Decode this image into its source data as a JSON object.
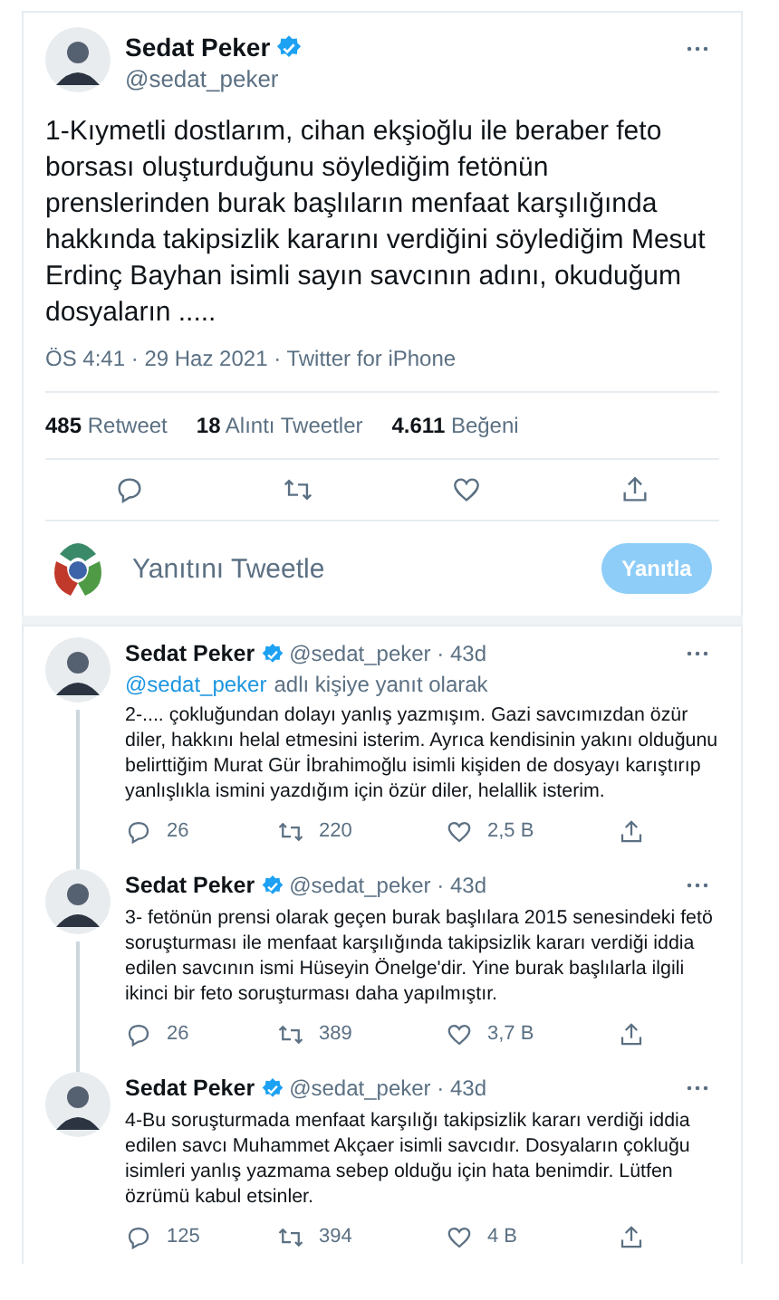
{
  "main_tweet": {
    "author": {
      "name": "Sedat Peker",
      "handle": "@sedat_peker",
      "verified": true
    },
    "text": "1-Kıymetli dostlarım, cihan ekşioğlu ile beraber feto borsası oluşturduğunu söylediğim fetönün prenslerinden burak başlıların menfaat karşılığında hakkında takipsizlik kararını verdiğini söylediğim Mesut Erdinç Bayhan isimli sayın savcının adını, okuduğum dosyaların .....",
    "meta": "ÖS 4:41 · 29 Haz 2021 · Twitter for iPhone",
    "stats": [
      {
        "count": "485",
        "label": "Retweet"
      },
      {
        "count": "18",
        "label": "Alıntı Tweetler"
      },
      {
        "count": "4.611",
        "label": "Beğeni"
      }
    ]
  },
  "reply_box": {
    "placeholder": "Yanıtını Tweetle",
    "button": {
      "label": "Yanıtla",
      "disabled": true
    }
  },
  "replies": [
    {
      "name": "Sedat Peker",
      "verified": true,
      "byline": "@sedat_peker · 43d",
      "replying_to": {
        "handle": "@sedat_peker",
        "text": "adlı kişiye yanıt olarak"
      },
      "text": "2-.... çokluğundan dolayı yanlış yazmışım. Gazi savcımızdan özür diler, hakkını helal etmesini isterim. Ayrıca kendisinin yakını olduğunu belirttiğim Murat Gür İbrahimoğlu isimli kişiden de dosyayı karıştırıp yanlışlıkla ismini yazdığım için özür diler, helallik isterim.",
      "replies": "26",
      "retweets": "220",
      "likes": "2,5 B"
    },
    {
      "name": "Sedat Peker",
      "verified": true,
      "byline": "@sedat_peker · 43d",
      "text": "3- fetönün prensi olarak geçen burak başlılara 2015 senesindeki fetö soruşturması ile menfaat karşılığında takipsizlik kararı verdiği iddia edilen savcının ismi Hüseyin Önelge'dir. Yine burak başlılarla ilgili ikinci bir feto soruşturması daha yapılmıştır.",
      "replies": "26",
      "retweets": "389",
      "likes": "3,7 B"
    },
    {
      "name": "Sedat Peker",
      "verified": true,
      "byline": "@sedat_peker · 43d",
      "text": "4-Bu soruşturmada menfaat karşılığı takipsizlik kararı verdiği iddia edilen savcı Muhammet Akçaer isimli savcıdır. Dosyaların çokluğu isimleri yanlış yazmama sebep olduğu için hata benimdir. Lütfen özrümü kabul etsinler.",
      "replies": "125",
      "retweets": "394",
      "likes": "4 B"
    }
  ]
}
